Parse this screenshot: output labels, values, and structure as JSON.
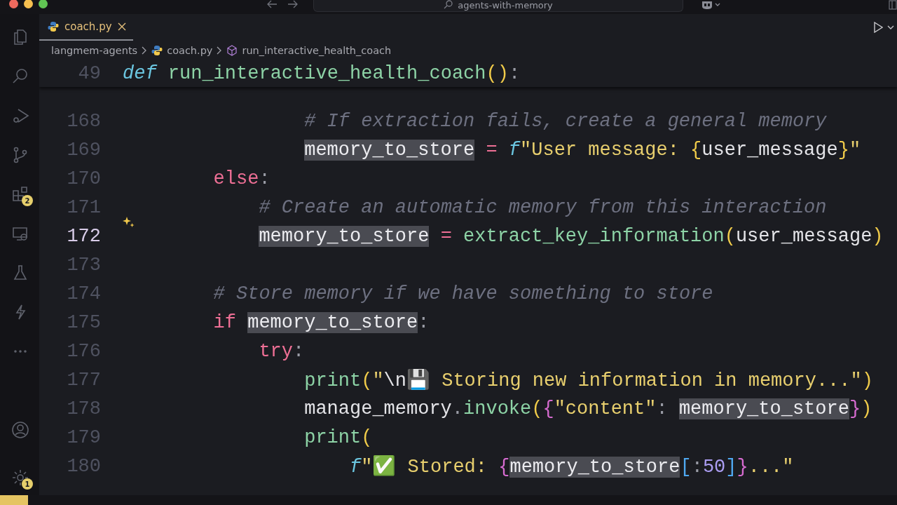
{
  "title_bar": {
    "search": "agents-with-memory"
  },
  "activity_bar": {
    "items": [
      {
        "kind": "explorer",
        "selected": false
      },
      {
        "kind": "search",
        "selected": false
      },
      {
        "kind": "debug",
        "selected": false
      },
      {
        "kind": "source_control",
        "selected": false
      },
      {
        "kind": "extensions",
        "selected": false,
        "badge": "2"
      },
      {
        "kind": "remote",
        "selected": false
      },
      {
        "kind": "testing",
        "selected": false
      },
      {
        "kind": "lightning",
        "selected": false
      },
      {
        "kind": "more",
        "selected": false
      }
    ],
    "bottom_items": [
      {
        "kind": "account",
        "selected": false
      },
      {
        "kind": "settings",
        "selected": false,
        "badge": "1"
      }
    ]
  },
  "tabs": [
    {
      "label": "coach.py",
      "selected": true
    }
  ],
  "breadcrumb": [
    {
      "label": "langmem-agents",
      "kind": "folder"
    },
    {
      "label": "coach.py",
      "kind": "file"
    },
    {
      "label": "run_interactive_health_coach",
      "kind": "symbol"
    }
  ],
  "sticky_line": {
    "number": "49",
    "tokens": [
      {
        "text": "def ",
        "kind": "def"
      },
      {
        "text": "run_interactive_health_coach",
        "kind": "fn"
      },
      {
        "text": "()",
        "kind": "paren"
      },
      {
        "text": ":",
        "kind": "punc"
      }
    ]
  },
  "lines": [
    {
      "children": [
        {
          "children": [
            {
              "number": "168",
              "current": false,
              "tokens": [
                {
                  "text": "# If extraction fails, create a general memory",
                  "kind": "comment"
                }
              ]
            },
            {
              "number": "169",
              "current": false,
              "tokens": [
                {
                  "text": "memory_to_store",
                  "kind": "match"
                },
                {
                  "text": " = ",
                  "kind": "op"
                },
                {
                  "text": "f",
                  "kind": "def"
                },
                {
                  "text": "\"User message: ",
                  "kind": "str"
                },
                {
                  "text": "{",
                  "kind": "paren"
                },
                {
                  "text": "user_message",
                  "kind": "var"
                },
                {
                  "text": "}",
                  "kind": "paren"
                },
                {
                  "text": "\"",
                  "kind": "str"
                }
              ]
            }
          ]
        }
      ]
    },
    {
      "number": "170",
      "current": false,
      "tokens": [
        {
          "text": "else",
          "kind": "kw"
        },
        {
          "text": ":",
          "kind": "punc"
        }
      ],
      "children": [
        {
          "number": "171",
          "current": false,
          "tokens": [
            {
              "text": "# Create an automatic memory from this interaction",
              "kind": "comment"
            }
          ]
        },
        {
          "number": "172",
          "current": true,
          "tokens": [
            {
              "text": "memory_to_store",
              "kind": "match"
            },
            {
              "text": " = ",
              "kind": "op"
            },
            {
              "text": "extract_key_information",
              "kind": "fn"
            },
            {
              "text": "(",
              "kind": "paren"
            },
            {
              "text": "user_message",
              "kind": "var"
            },
            {
              "text": ")",
              "kind": "paren"
            }
          ]
        }
      ]
    },
    {
      "number": "173",
      "current": false
    },
    {
      "number": "174",
      "current": false,
      "tokens": [
        {
          "text": "# Store memory if we have something to store",
          "kind": "comment"
        }
      ]
    },
    {
      "number": "175",
      "current": false,
      "tokens": [
        {
          "text": "if ",
          "kind": "kw"
        },
        {
          "text": "memory_to_store",
          "kind": "match"
        },
        {
          "text": ":",
          "kind": "punc"
        }
      ],
      "children": [
        {
          "number": "176",
          "current": false,
          "tokens": [
            {
              "text": "try",
              "kind": "kw"
            },
            {
              "text": ":",
              "kind": "punc"
            }
          ],
          "children": [
            {
              "number": "177",
              "current": false,
              "tokens": [
                {
                  "text": "print",
                  "kind": "fn"
                },
                {
                  "text": "(",
                  "kind": "paren"
                },
                {
                  "text": "\"",
                  "kind": "str"
                },
                {
                  "text": "\\n",
                  "kind": "var"
                },
                {
                  "text": "💾 Storing new information in memory...\"",
                  "kind": "str"
                },
                {
                  "text": ")",
                  "kind": "paren"
                }
              ]
            },
            {
              "number": "178",
              "current": false,
              "tokens": [
                {
                  "text": "manage_memory",
                  "kind": "var"
                },
                {
                  "text": ".",
                  "kind": "punc"
                },
                {
                  "text": "invoke",
                  "kind": "fn"
                },
                {
                  "text": "(",
                  "kind": "paren"
                },
                {
                  "text": "{",
                  "kind": "brace"
                },
                {
                  "text": "\"content\"",
                  "kind": "str"
                },
                {
                  "text": ": ",
                  "kind": "punc"
                },
                {
                  "text": "memory_to_store",
                  "kind": "match"
                },
                {
                  "text": "}",
                  "kind": "brace"
                },
                {
                  "text": ")",
                  "kind": "paren"
                }
              ]
            },
            {
              "number": "179",
              "current": false,
              "tokens": [
                {
                  "text": "print",
                  "kind": "fn"
                },
                {
                  "text": "(",
                  "kind": "paren"
                }
              ],
              "children": [
                {
                  "number": "180",
                  "current": false,
                  "tokens": [
                    {
                      "text": "f",
                      "kind": "def"
                    },
                    {
                      "text": "\"✅ Stored: ",
                      "kind": "str"
                    },
                    {
                      "text": "{",
                      "kind": "brace"
                    },
                    {
                      "text": "memory_to_store",
                      "kind": "match"
                    },
                    {
                      "text": "[",
                      "kind": "bracket"
                    },
                    {
                      "text": ":",
                      "kind": "punc"
                    },
                    {
                      "text": "50",
                      "kind": "num"
                    },
                    {
                      "text": "]",
                      "kind": "bracket"
                    },
                    {
                      "text": "}",
                      "kind": "brace"
                    },
                    {
                      "text": "...\"",
                      "kind": "str"
                    }
                  ]
                }
              ]
            }
          ]
        }
      ]
    }
  ]
}
